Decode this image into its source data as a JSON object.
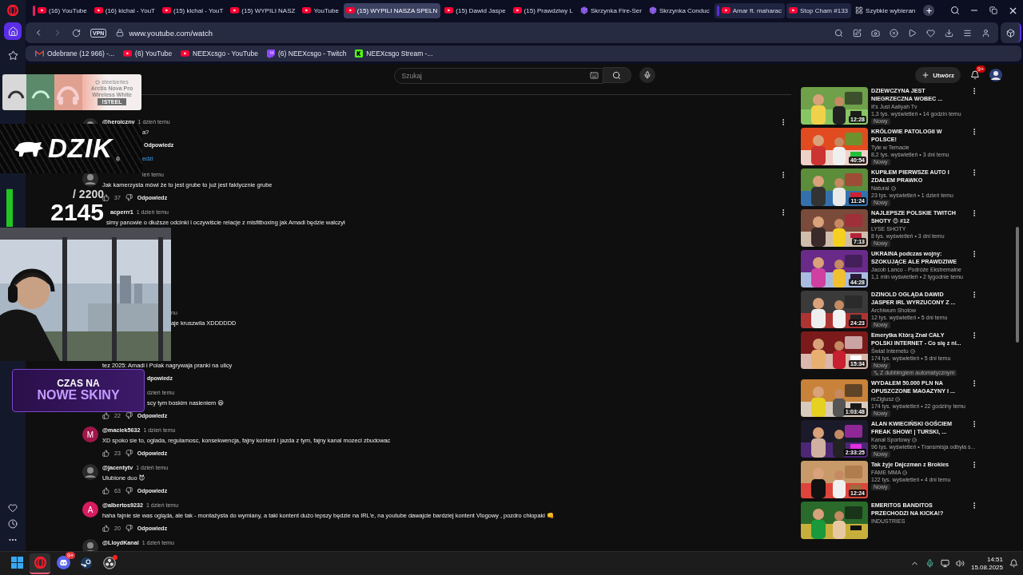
{
  "browser": {
    "tabs": [
      {
        "title": "(16) YouTube",
        "kind": "youtube",
        "selected": false,
        "island": false,
        "color": "#e0245e"
      },
      {
        "title": "(16) kichal - YouT",
        "kind": "youtube",
        "selected": false,
        "island": false
      },
      {
        "title": "(15) kichal - YouT",
        "kind": "youtube",
        "selected": false,
        "island": false
      },
      {
        "title": "(15) WYPILI NASZ",
        "kind": "youtube",
        "selected": false,
        "island": false
      },
      {
        "title": "YouTube",
        "kind": "youtube",
        "selected": false,
        "island": false
      },
      {
        "title": "(15) WYPILI NASZA SPELN",
        "kind": "youtube",
        "selected": true,
        "island": false
      },
      {
        "title": "(15) Dawid Jaspe",
        "kind": "youtube",
        "selected": false,
        "island": false
      },
      {
        "title": "(15) Prawdziwy L",
        "kind": "youtube",
        "selected": false,
        "island": false
      },
      {
        "title": "Skrzynka Fire-Ser",
        "kind": "box",
        "selected": false,
        "island": false
      },
      {
        "title": "Skrzynka Conduc",
        "kind": "box",
        "selected": false,
        "island": false
      },
      {
        "title": "Amar ft. maharac",
        "kind": "youtube",
        "selected": false,
        "island": true,
        "color": "#5b2be0"
      },
      {
        "title": "Stop Cham #133",
        "kind": "youtube",
        "selected": false,
        "island": true
      },
      {
        "title": "Szybkie wybieran",
        "kind": "grid",
        "selected": false,
        "island": false
      }
    ],
    "address": {
      "vpn": "VPN",
      "url": "www.youtube.com/watch"
    },
    "bookmarks": [
      {
        "title": "Odebrane (12 966) -...",
        "kind": "gmail"
      },
      {
        "title": "(6) YouTube",
        "kind": "youtube"
      },
      {
        "title": "NEEXcsgo - YouTube",
        "kind": "youtube"
      },
      {
        "title": "(6) NEEXcsgo - Twitch",
        "kind": "twitch"
      },
      {
        "title": "NEEXcsgo Stream -...",
        "kind": "kick"
      }
    ],
    "sidebar": {
      "items": [
        {
          "selected": true
        },
        {
          "selected": false
        }
      ]
    }
  },
  "youtube": {
    "search": {
      "placeholder": "Szukaj"
    },
    "create": "Utwórz",
    "notifications": "9+",
    "comments": [
      {
        "author": "@heroiczny",
        "time": "1 dzień temu",
        "text": "a?",
        "reply": "Odpowiedz",
        "replies": "edzi",
        "menu": true
      },
      {
        "time": "ień temu",
        "text": "Jak kamerzysta mówi że to jest grube to już jest faktycznie grube",
        "likes": "37",
        "reply": "Odpowiedz",
        "menu": true
      },
      {
        "author": "acperrr1",
        "time": "1 dzień temu",
        "text": "simy panowie o dłuższe odcinki i oczywiście relacje z misfitboxing jak Amadi będzie walczył",
        "menu": true
      },
      {
        "time": "nu",
        "text": "aje kruszwila XDDDDDD",
        "menu": false
      },
      {
        "text": "tez 2025: Amadi i Polak nagrywaja pranki na ulicy",
        "reply": "dpowiedz",
        "menu": false
      },
      {
        "time": "dzień temu",
        "text": "scy tym boskim nasieniem 😆",
        "likes": "22",
        "reply": "Odpowiedz",
        "menu": false
      },
      {
        "avatar": {
          "kind": "letter",
          "letter": "M",
          "color": "#a0164a"
        },
        "author": "@maciek5632",
        "time": "1 dzień temu",
        "text": "XD spoko sie to, oglada, regulamosc, konsekwencja, fajny kontent i jazda z tym, fajny kanal mozeci zbudowac",
        "likes": "23",
        "reply": "Odpowiedz",
        "menu": false
      },
      {
        "author": "@jacentytv",
        "time": "1 dzień temu",
        "text": "Ulubione duo 😈",
        "likes": "63",
        "reply": "Odpowiedz",
        "menu": false
      },
      {
        "avatar": {
          "kind": "letter",
          "letter": "A",
          "color": "#d81b60"
        },
        "author": "@albertos9232",
        "time": "1 dzień temu",
        "text": "haha fajnie sie was ogląda, ale tak - montażysta do wymiany, a taki kontent dużo lepszy będzie na IRL'e, na youtube dawajcie bardziej kontent Vlogowy , pozdro chłopaki 👊",
        "likes": "20",
        "reply": "Odpowiedz",
        "menu": false
      },
      {
        "author": "@LloydKanal",
        "time": "1 dzień temu",
        "menu": false
      }
    ],
    "recommended": [
      {
        "title": "DZIEWCZYNA JEST NIEGRZECZNA WOBEC ...",
        "channel": "It's Just Aaliyah Tv",
        "verified": false,
        "stats": "1,3 tys. wyświetleń • 14 godzin temu",
        "badges": [
          {
            "label": "Nowy",
            "kind": "new"
          }
        ],
        "duration": "12:28"
      },
      {
        "title": "KRÓLOWIE PATOLOGII W POLSCE!",
        "channel": "Tyle w Temacie",
        "verified": false,
        "stats": "8,2 tys. wyświetleń • 3 dni temu",
        "badges": [
          {
            "label": "Nowy",
            "kind": "new"
          }
        ],
        "duration": "40:54"
      },
      {
        "title": "KUPIŁEM PIERWSZE AUTO I ZDAŁEM PRAWKO",
        "channel": "Natural",
        "verified": true,
        "stats": "23 tys. wyświetleń • 1 dzień temu",
        "badges": [
          {
            "label": "Nowy",
            "kind": "new"
          }
        ],
        "duration": "11:24"
      },
      {
        "title": "NAJLEPSZE POLSKIE TWITCH SHOTY 😍 #12",
        "channel": "LYSE SHOTY",
        "verified": false,
        "stats": "8 tys. wyświetleń • 3 dni temu",
        "badges": [
          {
            "label": "Nowy",
            "kind": "new"
          }
        ],
        "duration": "7:13"
      },
      {
        "title": "UKRAINA podczas wojny: SZOKUJĄCE ALE PRAWDZIWE",
        "channel": "Jacob Lanco - Podróże Ekstremalne",
        "verified": false,
        "stats": "1,1 mln wyświetleń • 2 tygodnie temu",
        "duration": "44:28"
      },
      {
        "title": "DZINOLD OGLĄDA DAWID JASPER IRL WYRZUCONY Z ...",
        "channel": "Archiwum Shotów",
        "verified": false,
        "stats": "12 tys. wyświetleń • 5 dni temu",
        "badges": [
          {
            "label": "Nowy",
            "kind": "new"
          }
        ],
        "duration": "24:23"
      },
      {
        "title": "Emerytka Którą Znał CAŁY POLSKI INTERNET - Co się z ni...",
        "channel": "Świat Internetu",
        "verified": true,
        "stats": "174 tys. wyświetleń • 5 dni temu",
        "badges": [
          {
            "label": "Nowy",
            "kind": "new"
          },
          {
            "label": "Z dubbingiem automatycznym",
            "kind": "dubbed"
          }
        ],
        "duration": "15:34"
      },
      {
        "title": "WYDAŁEM 50.000 PLN NA OPUSZCZONE MAGAZYNY I ...",
        "channel": "reZigiusz",
        "verified": true,
        "stats": "174 tys. wyświetleń • 22 godziny temu",
        "badges": [
          {
            "label": "Nowy",
            "kind": "new"
          }
        ],
        "duration": "1:03:48"
      },
      {
        "title": "ALAN KWIECIŃSKI GOŚCIEM FREAK SHOW! | TURSKI, ...",
        "channel": "Kanał Sportowy",
        "verified": true,
        "stats": "96 tys. wyświetleń • Transmisja odbyła s...",
        "badges": [
          {
            "label": "Nowy",
            "kind": "new"
          }
        ],
        "duration": "2:33:25"
      },
      {
        "title": "Tak żyje Dajczman z Brokies",
        "channel": "FAME MMA",
        "verified": true,
        "stats": "122 tys. wyświetleń • 4 dni temu",
        "badges": [
          {
            "label": "Nowy",
            "kind": "new"
          }
        ],
        "duration": "12:24"
      },
      {
        "title": "EMERITOS BANDITOS PRZECHODZI NA KICKA!?",
        "channel": "INDUSTRIES",
        "verified": false
      }
    ]
  },
  "stream_overlay": {
    "ad": {
      "brand": "steelseries",
      "product": [
        "Arctis Nova Pro",
        "Wireless White"
      ],
      "code": "!STEEL"
    },
    "logo": {
      "text": "DZIK",
      "mark": "®"
    },
    "counter": {
      "goal": "/ 2200",
      "value": "2145",
      "level": 0.97
    },
    "banner": {
      "lines": [
        "CZAS NA",
        "NOWE SKINY"
      ]
    }
  },
  "taskbar": {
    "apps": [
      {
        "kind": "windows",
        "selected": false,
        "alert": false
      },
      {
        "kind": "opera",
        "selected": true,
        "alert": false
      },
      {
        "kind": "discord",
        "selected": false,
        "alert": false,
        "badge": "9+"
      },
      {
        "kind": "steam",
        "selected": false,
        "alert": false
      },
      {
        "kind": "obs",
        "selected": false,
        "alert": true
      }
    ],
    "time": "14:51",
    "date": "15.08.2025"
  }
}
